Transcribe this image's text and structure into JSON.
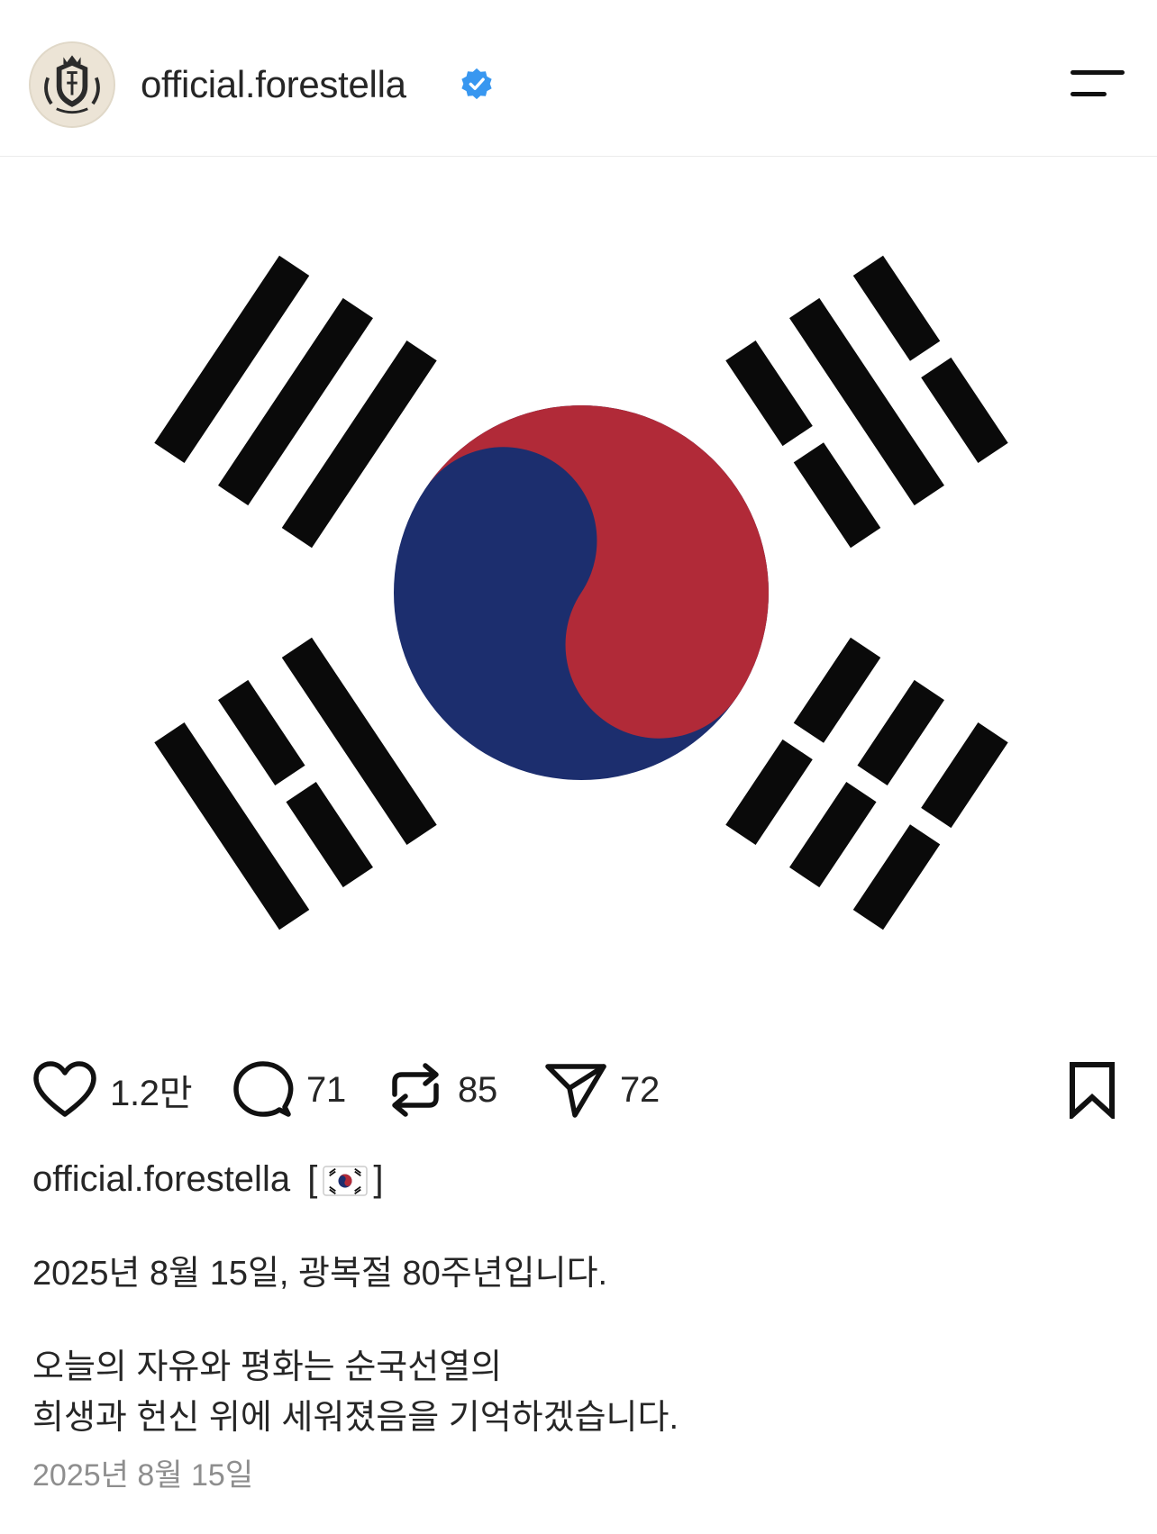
{
  "header": {
    "username": "official.forestella",
    "verified": true,
    "avatar_icon": "crest-logo-icon",
    "menu_icon": "menu-icon"
  },
  "post": {
    "image_subject": "taegukgi",
    "colors": {
      "flag_red": "#b12a38",
      "flag_blue": "#1c2e6e",
      "trigram": "#0a0a0a",
      "verified_blue": "#3897f0"
    }
  },
  "actions": {
    "likes": "1.2만",
    "comments": "71",
    "reposts": "85",
    "shares": "72",
    "icons": [
      "heart-icon",
      "comment-icon",
      "repost-icon",
      "share-icon",
      "bookmark-icon"
    ]
  },
  "caption": {
    "username": "official.forestella",
    "bracket_open": "[",
    "bracket_close": "]",
    "line1": "2025년 8월 15일, 광복절 80주년입니다.",
    "line2": "오늘의 자유와 평화는 순국선열의",
    "line3": "희생과 헌신 위에 세워졌음을 기억하겠습니다."
  },
  "date": "2025년 8월 15일"
}
